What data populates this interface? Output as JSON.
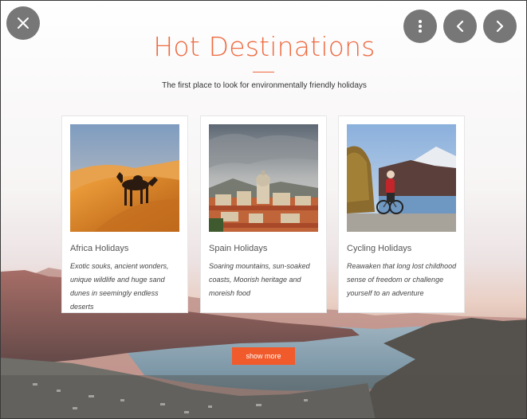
{
  "viewer": {
    "close_icon": "close-icon",
    "more_icon": "more-vertical-icon",
    "prev_icon": "chevron-left-icon",
    "next_icon": "chevron-right-icon"
  },
  "page": {
    "title": "Hot Destinations",
    "subtitle": "The first place to look for environmentally friendly holidays",
    "accent_color": "#ee6a40",
    "button_color": "#f15a2b"
  },
  "cards": [
    {
      "title": "Africa Holidays",
      "description": "Exotic souks, ancient wonders, unique wildlife and huge sand dunes in seemingly endless deserts",
      "image": "desert-camel"
    },
    {
      "title": "Spain Holidays",
      "description": "Soaring mountains, sun-soaked coasts, Moorish heritage and moreish food",
      "image": "spanish-town"
    },
    {
      "title": "Cycling Holidays",
      "description": "Reawaken that long lost childhood sense of freedom or challenge yourself to an adventure",
      "image": "cyclist-mountain"
    }
  ],
  "actions": {
    "show_more": "show more"
  }
}
